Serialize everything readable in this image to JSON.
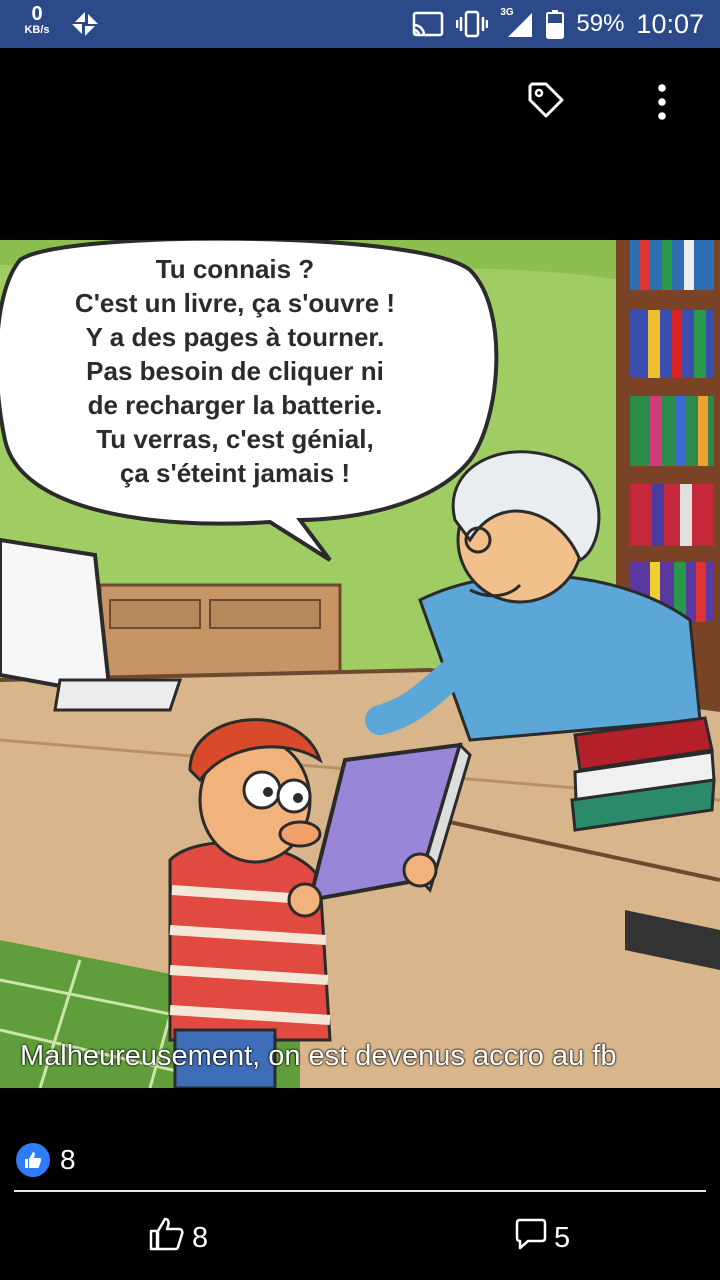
{
  "status_bar": {
    "net_speed": "0",
    "net_unit": "KB/s",
    "network_type": "3G",
    "battery": "59%",
    "time": "10:07"
  },
  "toolbar": {
    "tag_icon": "tag-icon",
    "more_icon": "more-vertical-icon"
  },
  "image": {
    "speech_bubble_lines": [
      "Tu connais ?",
      "C'est un livre, ça s'ouvre !",
      "Y a des pages à tourner.",
      "Pas besoin de cliquer ni",
      "de recharger la batterie.",
      "Tu verras, c'est génial,",
      "ça s'éteint jamais !"
    ]
  },
  "post": {
    "caption": "Malheureusement, on est devenus accro au fb",
    "reaction_count": "8"
  },
  "actions": {
    "like_count": "8",
    "comment_count": "5"
  },
  "colors": {
    "status_bar": "#2c4a8a",
    "like_blue": "#2f7df6"
  }
}
